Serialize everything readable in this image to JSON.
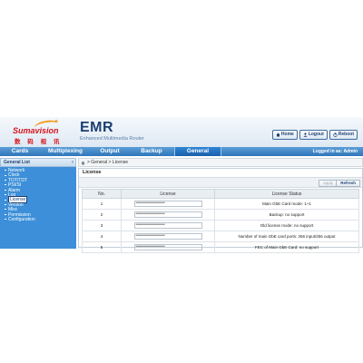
{
  "brand": {
    "logo_word": "Sumavision",
    "logo_cn": "数 码 视 讯"
  },
  "product": {
    "name": "EMR",
    "subtitle": "Enhanced Multimedia Router"
  },
  "top_buttons": [
    {
      "label": "Home",
      "icon": "home-icon"
    },
    {
      "label": "Logout",
      "icon": "user-icon"
    },
    {
      "label": "Reboot",
      "icon": "power-icon"
    }
  ],
  "nav": {
    "tabs": [
      "Cards",
      "Multiplexing",
      "Output",
      "Backup",
      "General"
    ],
    "active": "General",
    "logged_in": "Logged in as: Admin"
  },
  "sidebar": {
    "title": "General List",
    "items": [
      "Network",
      "Clock",
      "TOT/TDT",
      "PSI/SI",
      "Alarm",
      "Log",
      "License",
      "Version",
      "Misc",
      "Permission",
      "Configuration"
    ],
    "active": "License"
  },
  "breadcrumb": "> General > License",
  "panel": {
    "title": "License",
    "apply_label": "Apply",
    "refresh_label": "Refresh",
    "columns": [
      "No.",
      "License",
      "License Status"
    ],
    "rows": [
      {
        "no": "1",
        "license": "**********************************",
        "status": "Main GbE Card mode: 1+1"
      },
      {
        "no": "2",
        "license": "**********************************",
        "status": "Backup: no support"
      },
      {
        "no": "3",
        "license": "**********************************",
        "status": "Old license mode: no support"
      },
      {
        "no": "4",
        "license": "**********************************",
        "status": "Number of main GbE card ports: 256 input/256 output"
      },
      {
        "no": "5",
        "license": "**********************************",
        "status": "FEC of Main GbE Card: no support"
      }
    ]
  },
  "colors": {
    "nav_blue": "#2f76ba",
    "sidebar_blue": "#3c8fd8",
    "brand_red": "#d4141b",
    "brand_orange": "#f29a1d"
  }
}
